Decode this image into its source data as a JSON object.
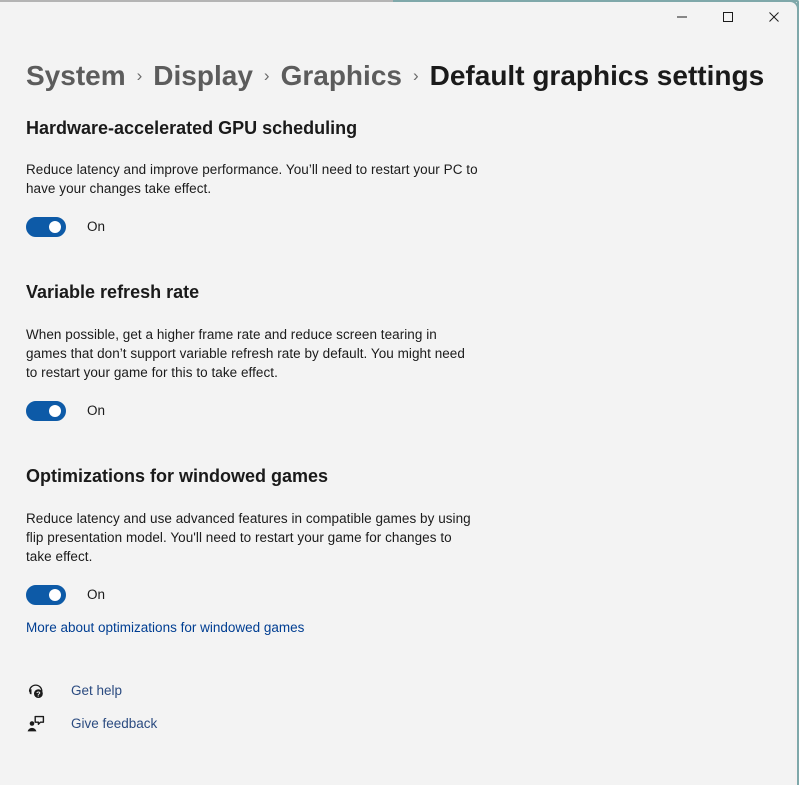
{
  "window": {
    "accent_color": "#7fa8aa",
    "background_color": "#f3f3f3",
    "caption_buttons": [
      {
        "name": "minimize",
        "glyph": "─",
        "tooltip": "Minimize"
      },
      {
        "name": "maximize",
        "glyph": "☐",
        "tooltip": "Maximize"
      },
      {
        "name": "close",
        "glyph": "✕",
        "tooltip": "Close"
      }
    ]
  },
  "breadcrumb": {
    "separator": "›",
    "items": [
      {
        "label": "System",
        "current": false
      },
      {
        "label": "Display",
        "current": false
      },
      {
        "label": "Graphics",
        "current": false
      },
      {
        "label": "Default graphics settings",
        "current": true
      }
    ]
  },
  "sections": [
    {
      "title": "Hardware-accelerated GPU scheduling",
      "description": "Reduce latency and improve performance. You’ll need to restart your PC to have your changes take effect.",
      "toggle": {
        "state": "On",
        "on": true
      },
      "link": null
    },
    {
      "title": "Variable refresh rate",
      "description": "When possible, get a higher frame rate and reduce screen tearing in games that don’t support variable refresh rate by default. You might need to restart your game for this to take effect.",
      "toggle": {
        "state": "On",
        "on": true
      },
      "link": null
    },
    {
      "title": "Optimizations for windowed games",
      "description": "Reduce latency and use advanced features in compatible games by using flip presentation model. You'll need to restart your game for changes to take effect.",
      "toggle": {
        "state": "On",
        "on": true
      },
      "link": {
        "label": "More about optimizations for windowed games",
        "color": "#003e92"
      }
    }
  ],
  "footer": {
    "items": [
      {
        "icon": "help-headset-icon",
        "label": "Get help"
      },
      {
        "icon": "feedback-person-icon",
        "label": "Give feedback"
      }
    ]
  }
}
